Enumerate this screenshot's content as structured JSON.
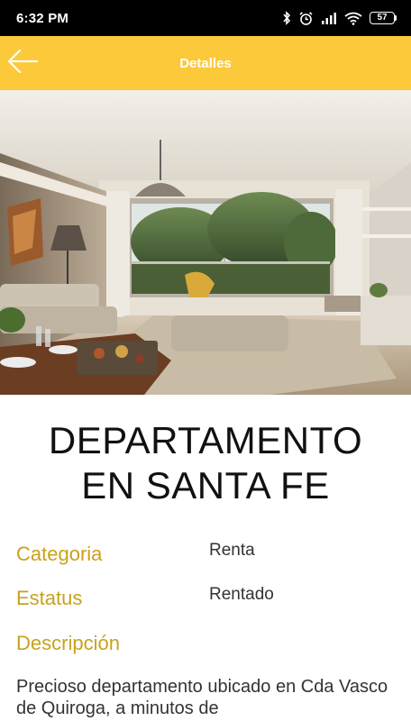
{
  "status_bar": {
    "time": "6:32 PM",
    "battery_level": "57",
    "icons": [
      "bluetooth-icon",
      "alarm-icon",
      "signal-icon",
      "wifi-icon",
      "battery-icon"
    ]
  },
  "app_bar": {
    "title": "Detalles",
    "back_icon": "arrow-left-icon",
    "color": "#fbc93a"
  },
  "hero_image": {
    "subject": "living-room-interior-photo"
  },
  "property": {
    "title_line1": "DEPARTAMENTO",
    "title_line2": "EN SANTA FE",
    "details": [
      {
        "label": "Categoria",
        "value": "Renta"
      },
      {
        "label": "Estatus",
        "value": "Rentado"
      }
    ],
    "description_label": "Descripción",
    "description_text": "Precioso departamento ubicado en Cda Vasco de Quiroga, a minutos de"
  },
  "colors": {
    "accent": "#fbc93a",
    "label": "#c9a21a",
    "text": "#333333"
  }
}
